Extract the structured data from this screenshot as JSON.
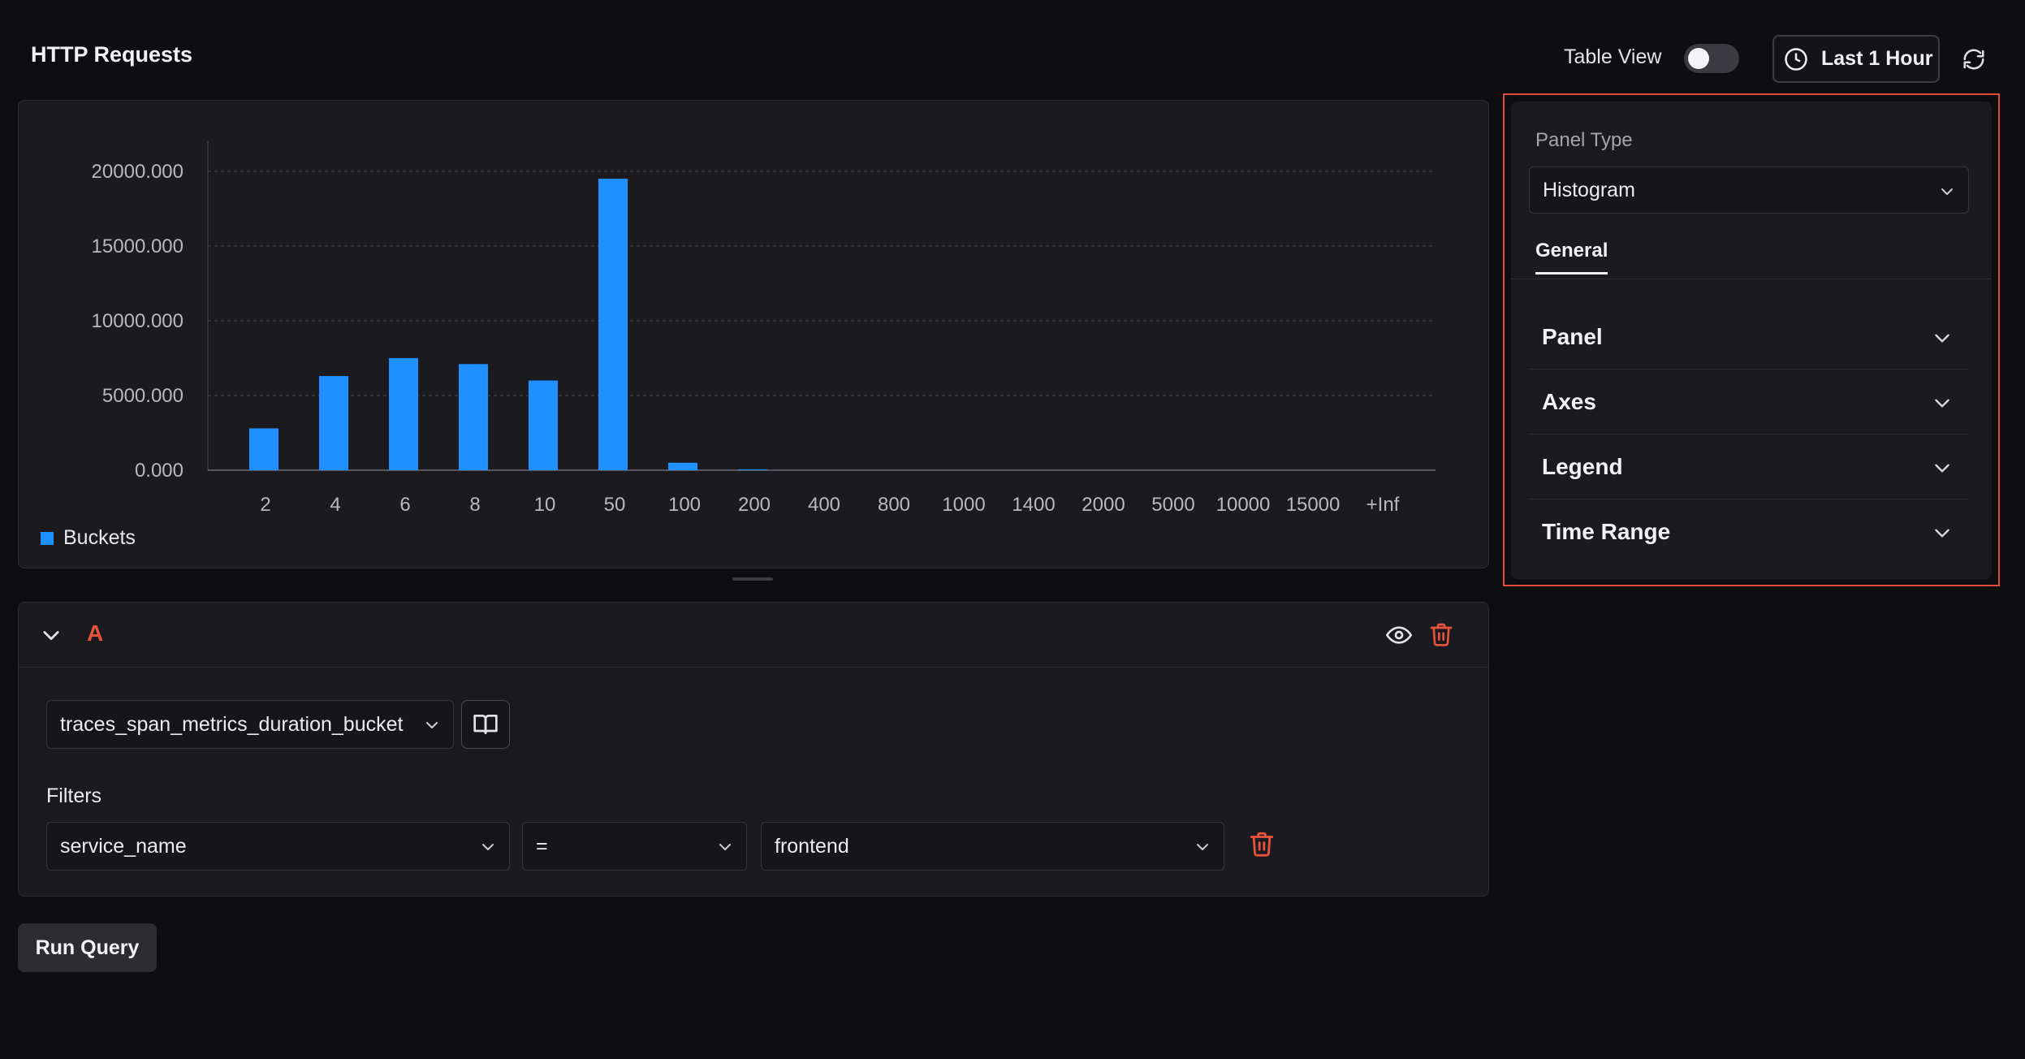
{
  "header": {
    "title": "HTTP Requests",
    "table_view_label": "Table View",
    "table_view_on": false,
    "time_range_label": "Last 1 Hour"
  },
  "chart_data": {
    "type": "bar",
    "categories": [
      "2",
      "4",
      "6",
      "8",
      "10",
      "50",
      "100",
      "200",
      "400",
      "800",
      "1000",
      "1400",
      "2000",
      "5000",
      "10000",
      "15000",
      "+Inf"
    ],
    "series": [
      {
        "name": "Buckets",
        "values": [
          2800,
          6300,
          7500,
          7100,
          6000,
          19500,
          500,
          60,
          0,
          0,
          0,
          0,
          0,
          0,
          0,
          0,
          0
        ]
      }
    ],
    "yticks": [
      "0.000",
      "5000.000",
      "10000.000",
      "15000.000",
      "20000.000"
    ],
    "ylim": [
      0,
      22000
    ],
    "grid": true,
    "legend": "bottom-left",
    "color": "#1e90ff"
  },
  "query": {
    "letter": "A",
    "metric": "traces_span_metrics_duration_bucket",
    "filters_label": "Filters",
    "filter": {
      "key": "service_name",
      "operator": "=",
      "value": "frontend"
    },
    "run_label": "Run Query"
  },
  "side_panel": {
    "panel_type_label": "Panel Type",
    "panel_type_value": "Histogram",
    "tab_general": "General",
    "sections": [
      "Panel",
      "Axes",
      "Legend",
      "Time Range"
    ]
  },
  "colors": {
    "accent": "#1e90ff",
    "danger": "#e8533d",
    "highlight_border": "#e24a3b"
  }
}
